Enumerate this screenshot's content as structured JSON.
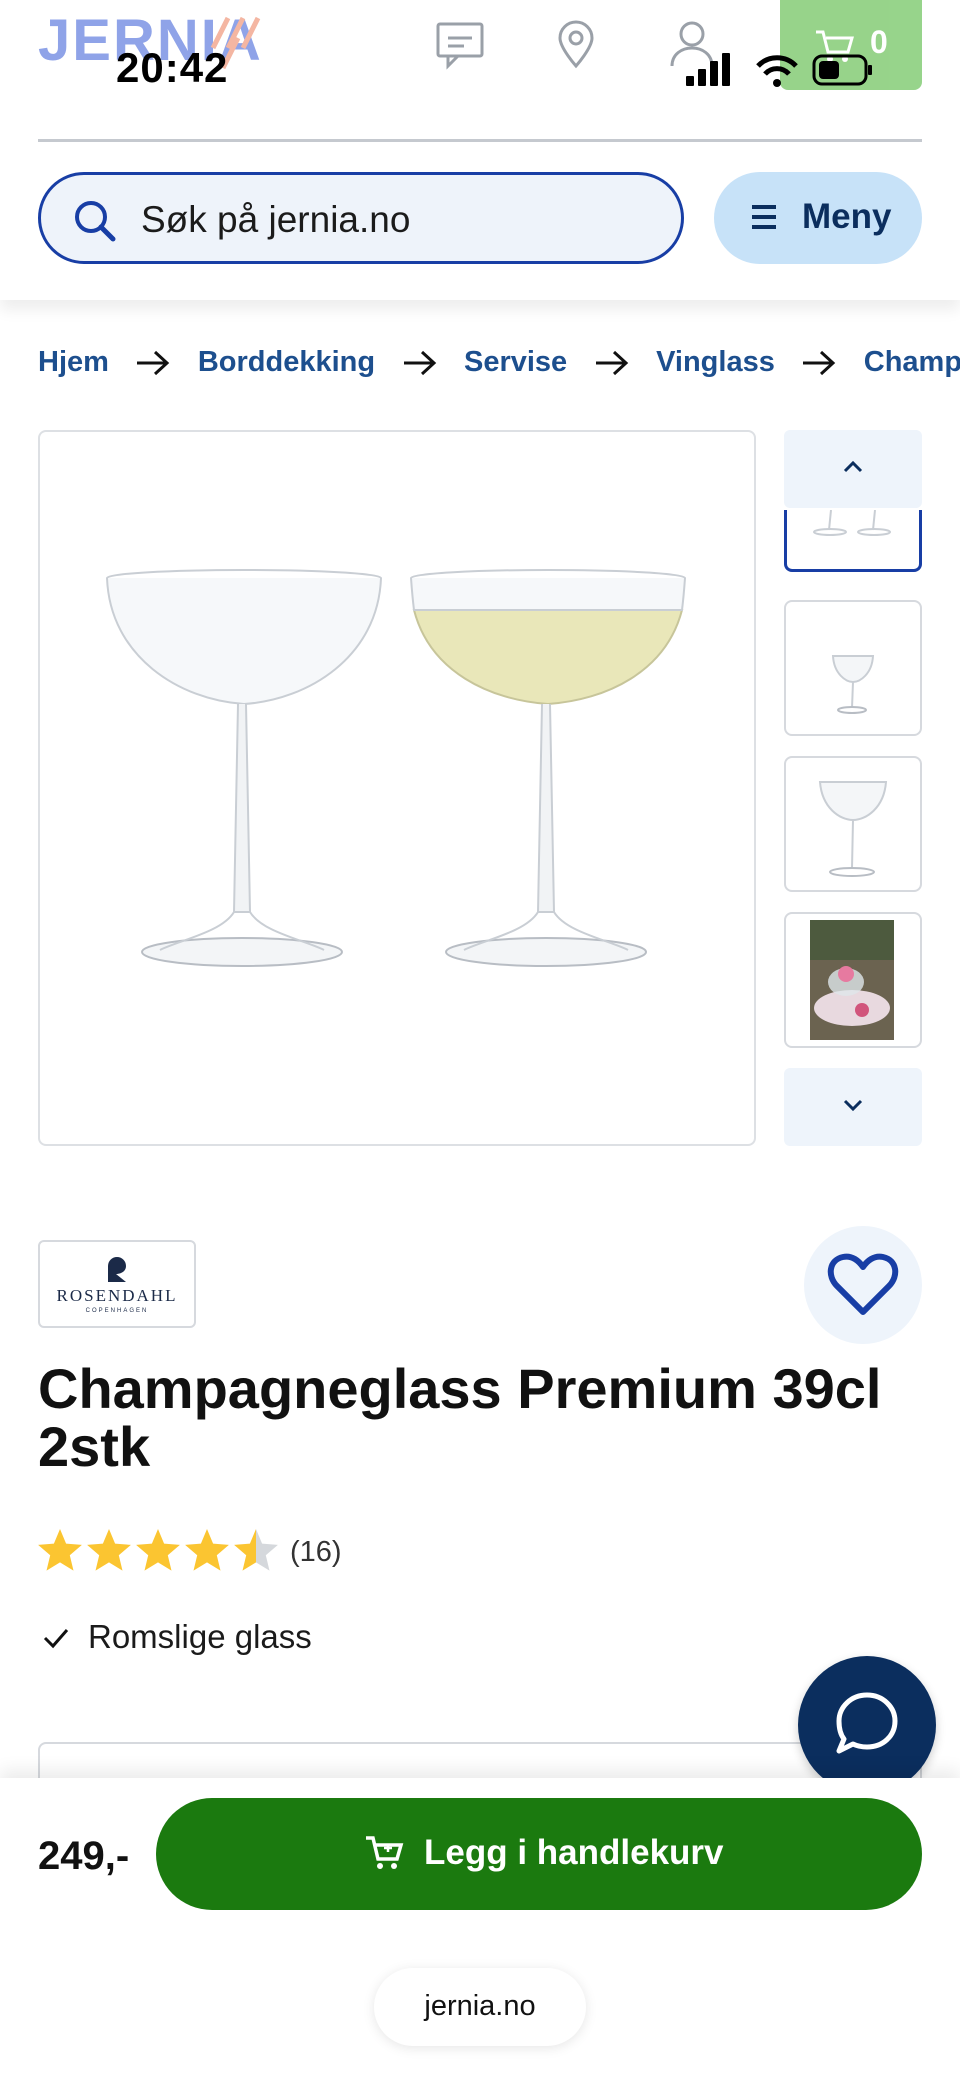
{
  "status_bar": {
    "time": "20:42"
  },
  "header": {
    "logo_text": "JERNIA",
    "cart_count": "0",
    "search_placeholder": "Søk på jernia.no",
    "menu_label": "Meny"
  },
  "breadcrumb": {
    "items": [
      "Hjem",
      "Borddekking",
      "Servise",
      "Vinglass",
      "Champa"
    ]
  },
  "brand": {
    "name": "ROSENDAHL",
    "subtitle": "COPENHAGEN"
  },
  "product": {
    "title": "Champagneglass Premium 39cl 2stk",
    "rating": 4.5,
    "rating_max": 5,
    "review_count": "(16)",
    "usp": "Romslige glass",
    "price": "249,-"
  },
  "actions": {
    "add_to_cart": "Legg i handlekurv"
  },
  "browser": {
    "url": "jernia.no"
  },
  "colors": {
    "primary_blue": "#183ea5",
    "navy": "#0b2e5e",
    "green": "#1b7a0f",
    "star": "#fbc531"
  }
}
